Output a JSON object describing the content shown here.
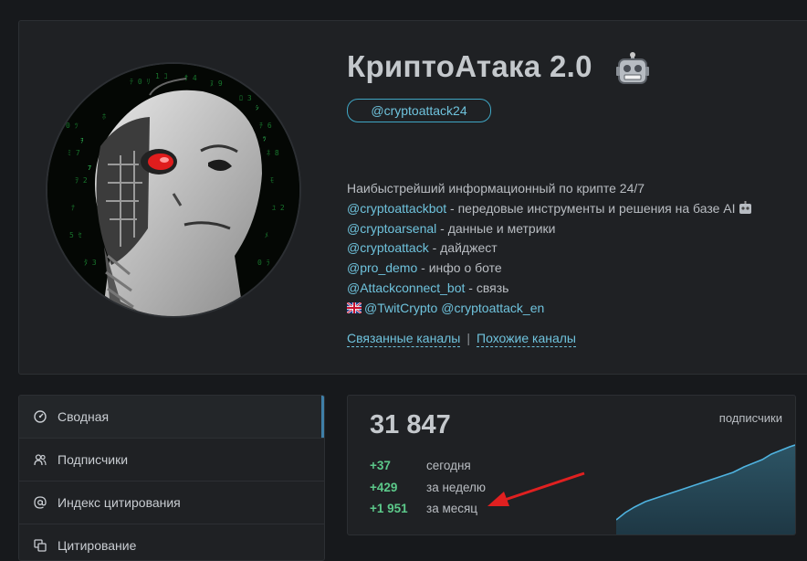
{
  "channel": {
    "title": "КриптоАтака 2.0",
    "handle": "@cryptoattack24",
    "avatar_description": "cyborg-face",
    "description": {
      "line1": "Наибыстрейший информационный по крипте 24/7",
      "lines": [
        {
          "link": "@cryptoattackbot",
          "text": " - передовые инструменты и решения на базе AI"
        },
        {
          "link": "@cryptoarsenal",
          "text": " - данные и метрики"
        },
        {
          "link": "@cryptoattack",
          "text": " - дайджест"
        },
        {
          "link": "@pro_demo",
          "text": " - инфо о боте"
        },
        {
          "link": "@Attackconnect_bot",
          "text": " - связь"
        }
      ],
      "last_line_links": [
        "@TwitCrypto",
        "@cryptoattack_en"
      ]
    },
    "related": {
      "linked": "Связанные каналы",
      "similar": "Похожие каналы",
      "separator": "|"
    }
  },
  "sidebar": {
    "items": [
      {
        "label": "Сводная",
        "icon": "dashboard-icon",
        "active": true
      },
      {
        "label": "Подписчики",
        "icon": "users-icon",
        "active": false
      },
      {
        "label": "Индекс цитирования",
        "icon": "at-icon",
        "active": false
      },
      {
        "label": "Цитирование",
        "icon": "copy-icon",
        "active": false
      }
    ]
  },
  "stats": {
    "subscribers_total": "31 847",
    "label": "подписчики",
    "rows": [
      {
        "value": "+37",
        "period": "сегодня"
      },
      {
        "value": "+429",
        "period": "за неделю"
      },
      {
        "value": "+1 951",
        "period": "за месяц"
      }
    ]
  },
  "colors": {
    "accent_link": "#6fc3dd",
    "positive": "#5cc98a",
    "spark_line": "#4fb3e0",
    "annotation_arrow": "#e02020"
  }
}
